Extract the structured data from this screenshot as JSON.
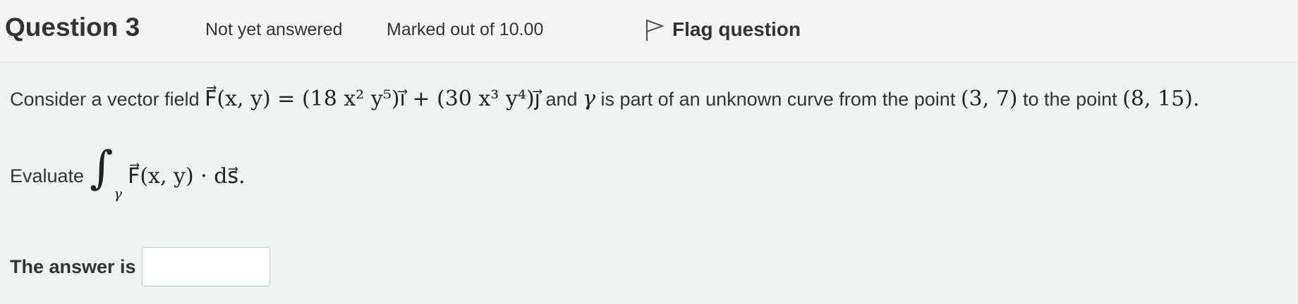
{
  "header": {
    "question_title": "Question 3",
    "state": "Not yet answered",
    "marks": "Marked out of 10.00",
    "flag_label": "Flag question",
    "flag_icon": "flag-outline-icon"
  },
  "question": {
    "intro": "Consider a vector field",
    "field_expr": "F⃗(x, y) = (18 x² y⁵)i⃗ + (30 x³ y⁴)j⃗",
    "and_text": "and",
    "gamma": "γ",
    "mid_text": "is part of an unknown curve from the point",
    "point_start": "(3, 7)",
    "to_text": "to the point",
    "point_end": "(8, 15).",
    "evaluate_label": "Evaluate",
    "integral_symbol": "∫",
    "integral_sub": "γ",
    "integrand": "F⃗(x, y) · ds⃗."
  },
  "answer": {
    "label": "The answer is",
    "value": "",
    "placeholder": ""
  }
}
